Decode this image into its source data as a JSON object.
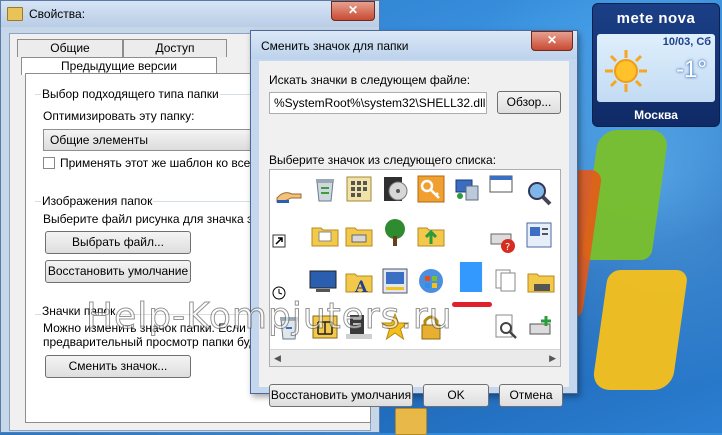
{
  "properties_window": {
    "title": "Свойства:",
    "close": "✕",
    "tabs": {
      "general": "Общие",
      "access": "Доступ",
      "previous_versions": "Предыдущие версии"
    },
    "folder_type_group": {
      "title": "Выбор подходящего типа папки",
      "optimize_label": "Оптимизировать эту папку:",
      "selected_value": "Общие элементы",
      "apply_template_label": "Применять этот же шаблон ко всем п"
    },
    "folder_pictures_group": {
      "title": "Изображения папок",
      "description": "Выберите файл рисунка для значка этой",
      "choose_file_button": "Выбрать файл...",
      "restore_default_button": "Восстановить умолчание"
    },
    "folder_icons_group": {
      "title": "Значки папок",
      "description_line1": "Можно изменить значок папки. Если изм",
      "description_line2": "предварительный просмотр папки будет",
      "change_icon_button": "Сменить значок..."
    }
  },
  "change_icon_dialog": {
    "title": "Сменить значок для папки",
    "close": "✕",
    "search_label": "Искать значки в следующем файле:",
    "file_path": "%SystemRoot%\\system32\\SHELL32.dll",
    "browse_button": "Обзор...",
    "select_label": "Выберите значок из следующего списка:",
    "restore_defaults_button": "Восстановить умолчания",
    "ok_button": "OK",
    "cancel_button": "Отмена",
    "icons": [
      "hand-sharing-icon",
      "recycle-bin-full-icon",
      "control-panel-icon",
      "media-disc-icon",
      "key-icon",
      "network-computer-icon",
      "window-icon",
      "magnifier-globe-icon",
      "shortcut-arrow-icon",
      "folder-documents-icon",
      "folder-printer-icon",
      "tree-icon",
      "folder-up-icon",
      "disconnected-printer-icon",
      "system-properties-icon",
      "clock-icon",
      "monitor-icon",
      "fonts-folder-icon",
      "network-display-icon",
      "windows-help-icon",
      "selected-icon",
      "documents-icon",
      "printer-folder-icon",
      "recycle-bin-empty-icon",
      "network-folder-icon",
      "server-icon",
      "star-icon",
      "lock-icon",
      "blank-icon",
      "search-document-icon",
      "printer-add-icon"
    ]
  },
  "weather_gadget": {
    "logo": "mete nova",
    "date": "10/03, Сб",
    "temperature": "-1°",
    "city": "Москва",
    "weather_icon": "sun-icon"
  },
  "watermark": "Help-Kompjuters.ru",
  "colors": {
    "selection": "#3399ff",
    "underline": "#e0202a",
    "accent_title": "#c4d7ee"
  }
}
